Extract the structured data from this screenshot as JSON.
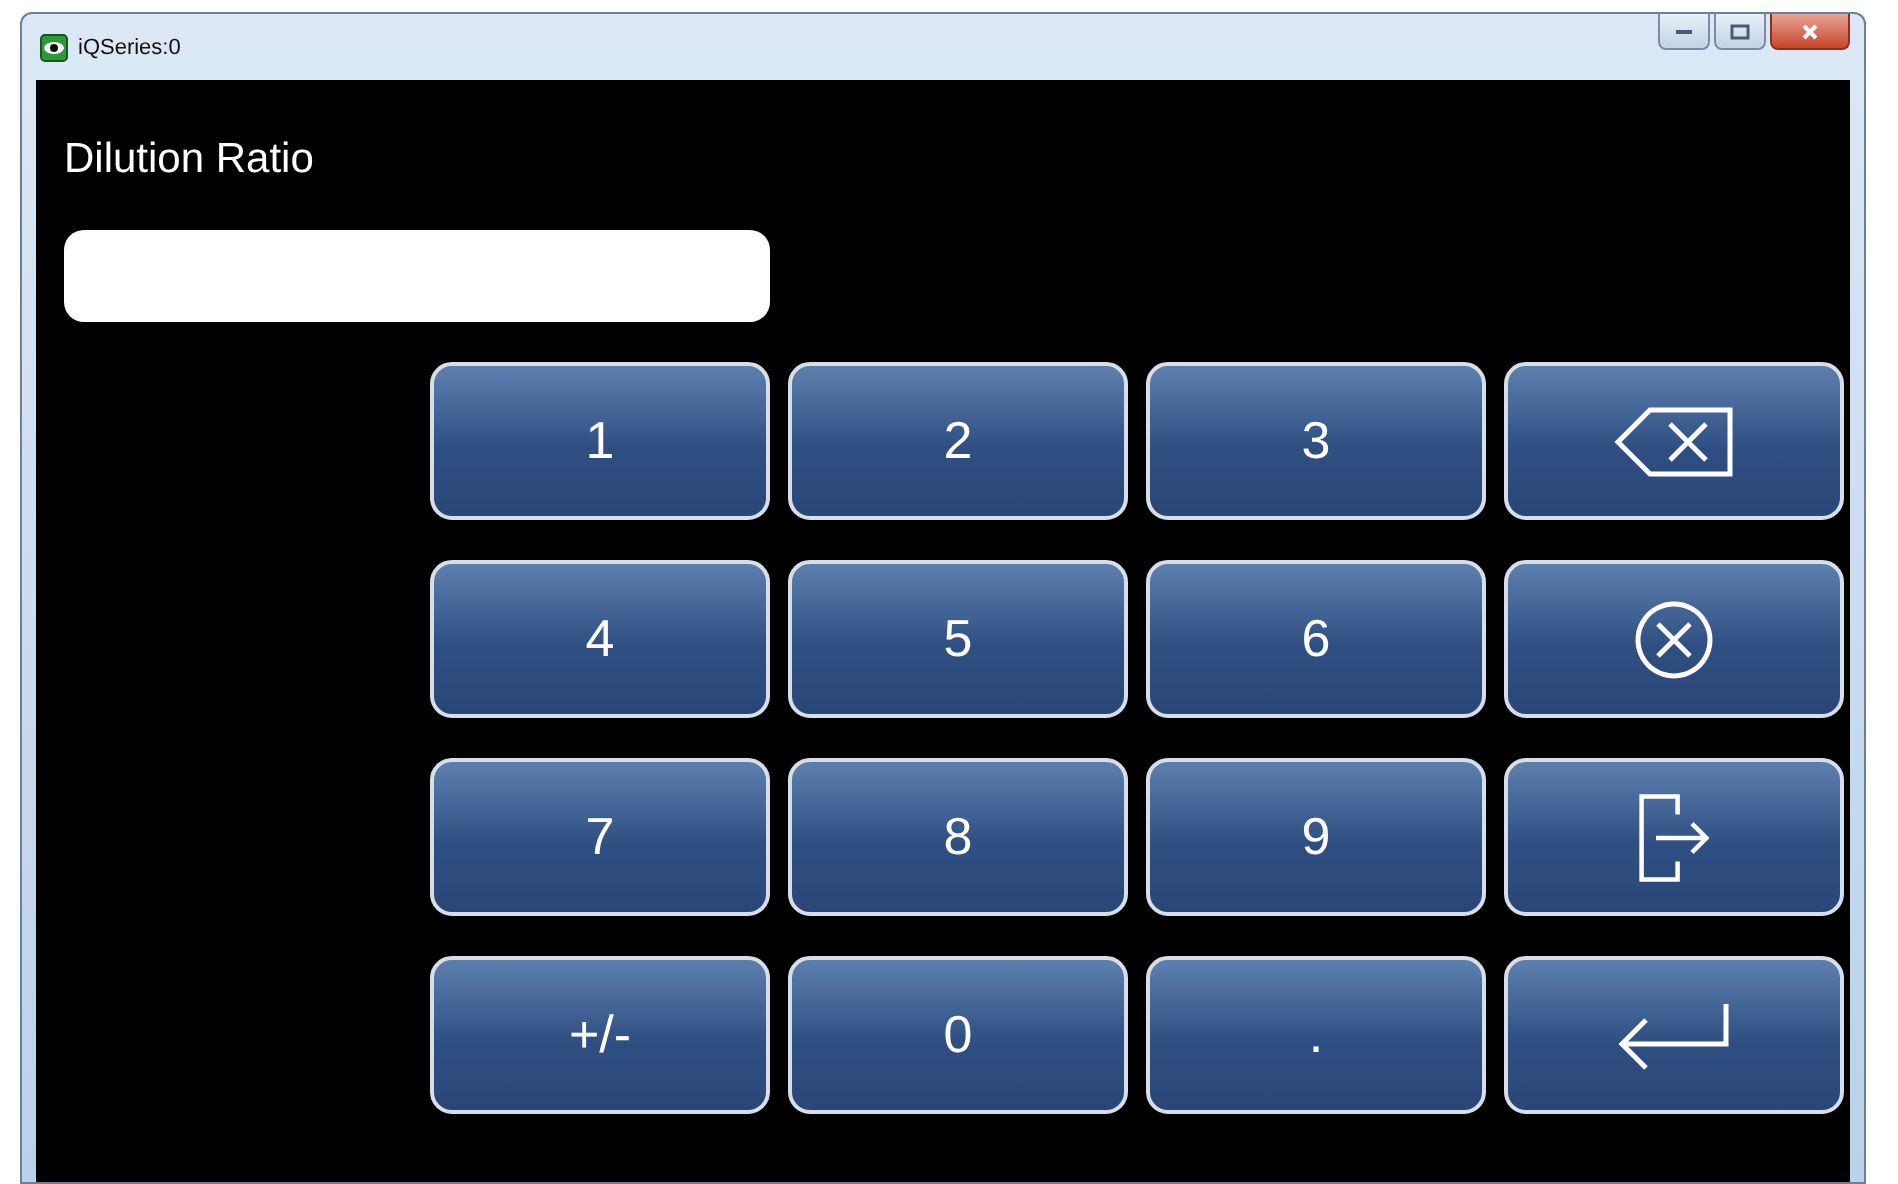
{
  "window": {
    "title": "iQSeries:0"
  },
  "prompt": "Dilution Ratio",
  "keys": [
    {
      "kind": "char",
      "label": "1"
    },
    {
      "kind": "char",
      "label": "2"
    },
    {
      "kind": "char",
      "label": "3"
    },
    {
      "kind": "backspace"
    },
    {
      "kind": "char",
      "label": "4"
    },
    {
      "kind": "char",
      "label": "5"
    },
    {
      "kind": "char",
      "label": "6"
    },
    {
      "kind": "clear"
    },
    {
      "kind": "char",
      "label": "7"
    },
    {
      "kind": "char",
      "label": "8"
    },
    {
      "kind": "char",
      "label": "9"
    },
    {
      "kind": "exit"
    },
    {
      "kind": "char",
      "label": "+/-"
    },
    {
      "kind": "char",
      "label": "0"
    },
    {
      "kind": "char",
      "label": "."
    },
    {
      "kind": "enter"
    }
  ]
}
